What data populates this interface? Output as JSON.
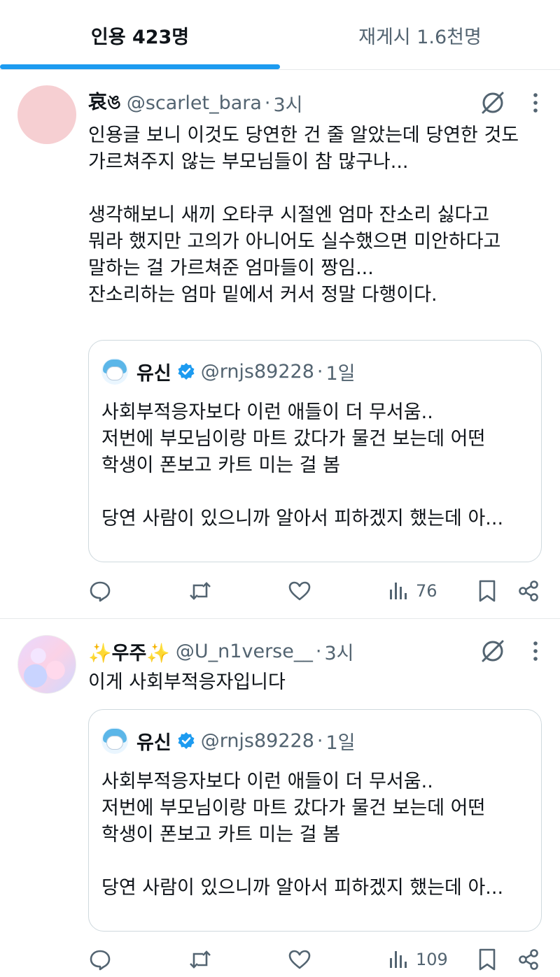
{
  "tabs": [
    {
      "label": "인용 423명",
      "active": true
    },
    {
      "label": "재게시 1.6천명",
      "active": false
    }
  ],
  "posts": [
    {
      "name": "哀ঙ",
      "handle": "@scarlet_bara",
      "separator": "·",
      "time": "3시",
      "text": "인용글 보니 이것도 당연한 건 줄 알았는데 당연한 것도\n가르쳐주지 않는 부모님들이 참 많구나...\n\n생각해보니 새끼 오타쿠 시절엔 엄마 잔소리 싫다고\n뭐라 했지만 고의가 아니어도 실수했으면 미안하다고\n말하는 걸 가르쳐준 엄마들이 짱임...\n잔소리하는 엄마 밑에서 커서 정말 다행이다.",
      "quote": {
        "name": "유신",
        "handle": "@rnjs89228",
        "separator": "·",
        "time": "1일",
        "text": "사회부적응자보다 이런 애들이 더 무서움..\n저번에 부모님이랑 마트 갔다가 물건 보는데 어떤\n학생이 폰보고 카트 미는 걸 봄\n\n당연 사람이 있으니까 알아서 피하겠지 했는데 아..."
      },
      "views": "76"
    },
    {
      "name": "✨우주✨",
      "handle": "@U_n1verse__",
      "separator": "·",
      "time": "3시",
      "text": "이게 사회부적응자입니다",
      "quote": {
        "name": "유신",
        "handle": "@rnjs89228",
        "separator": "·",
        "time": "1일",
        "text": "사회부적응자보다 이런 애들이 더 무서움..\n저번에 부모님이랑 마트 갔다가 물건 보는데 어떤\n학생이 폰보고 카트 미는 걸 봄\n\n당연 사람이 있으니까 알아서 피하겠지 했는데 아..."
      },
      "views": "109"
    }
  ],
  "colors": {
    "accent": "#1d9bf0",
    "secondary_text": "#536471",
    "primary_text": "#0f1419",
    "border": "#cfd9de"
  },
  "icons": {
    "header": [
      "grok-icon",
      "more-icon"
    ],
    "actions": [
      "reply-icon",
      "repost-icon",
      "like-icon",
      "views-icon",
      "bookmark-icon",
      "share-icon"
    ]
  }
}
